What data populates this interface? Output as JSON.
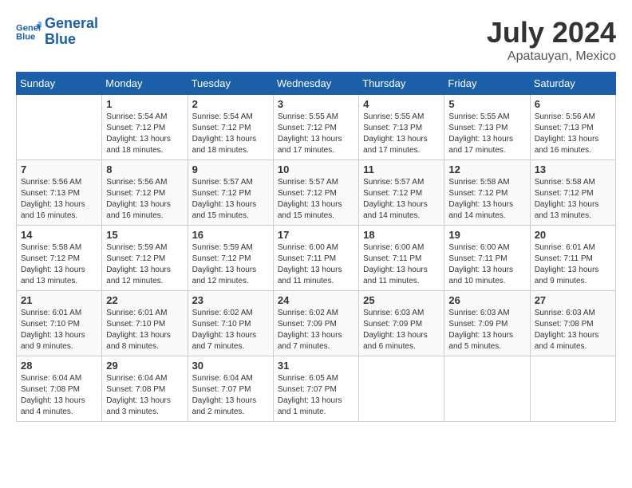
{
  "header": {
    "logo_line1": "General",
    "logo_line2": "Blue",
    "month": "July 2024",
    "location": "Apatauyan, Mexico"
  },
  "days_of_week": [
    "Sunday",
    "Monday",
    "Tuesday",
    "Wednesday",
    "Thursday",
    "Friday",
    "Saturday"
  ],
  "weeks": [
    [
      {
        "day": "",
        "info": ""
      },
      {
        "day": "1",
        "info": "Sunrise: 5:54 AM\nSunset: 7:12 PM\nDaylight: 13 hours\nand 18 minutes."
      },
      {
        "day": "2",
        "info": "Sunrise: 5:54 AM\nSunset: 7:12 PM\nDaylight: 13 hours\nand 18 minutes."
      },
      {
        "day": "3",
        "info": "Sunrise: 5:55 AM\nSunset: 7:12 PM\nDaylight: 13 hours\nand 17 minutes."
      },
      {
        "day": "4",
        "info": "Sunrise: 5:55 AM\nSunset: 7:13 PM\nDaylight: 13 hours\nand 17 minutes."
      },
      {
        "day": "5",
        "info": "Sunrise: 5:55 AM\nSunset: 7:13 PM\nDaylight: 13 hours\nand 17 minutes."
      },
      {
        "day": "6",
        "info": "Sunrise: 5:56 AM\nSunset: 7:13 PM\nDaylight: 13 hours\nand 16 minutes."
      }
    ],
    [
      {
        "day": "7",
        "info": "Sunrise: 5:56 AM\nSunset: 7:13 PM\nDaylight: 13 hours\nand 16 minutes."
      },
      {
        "day": "8",
        "info": "Sunrise: 5:56 AM\nSunset: 7:12 PM\nDaylight: 13 hours\nand 16 minutes."
      },
      {
        "day": "9",
        "info": "Sunrise: 5:57 AM\nSunset: 7:12 PM\nDaylight: 13 hours\nand 15 minutes."
      },
      {
        "day": "10",
        "info": "Sunrise: 5:57 AM\nSunset: 7:12 PM\nDaylight: 13 hours\nand 15 minutes."
      },
      {
        "day": "11",
        "info": "Sunrise: 5:57 AM\nSunset: 7:12 PM\nDaylight: 13 hours\nand 14 minutes."
      },
      {
        "day": "12",
        "info": "Sunrise: 5:58 AM\nSunset: 7:12 PM\nDaylight: 13 hours\nand 14 minutes."
      },
      {
        "day": "13",
        "info": "Sunrise: 5:58 AM\nSunset: 7:12 PM\nDaylight: 13 hours\nand 13 minutes."
      }
    ],
    [
      {
        "day": "14",
        "info": "Sunrise: 5:58 AM\nSunset: 7:12 PM\nDaylight: 13 hours\nand 13 minutes."
      },
      {
        "day": "15",
        "info": "Sunrise: 5:59 AM\nSunset: 7:12 PM\nDaylight: 13 hours\nand 12 minutes."
      },
      {
        "day": "16",
        "info": "Sunrise: 5:59 AM\nSunset: 7:12 PM\nDaylight: 13 hours\nand 12 minutes."
      },
      {
        "day": "17",
        "info": "Sunrise: 6:00 AM\nSunset: 7:11 PM\nDaylight: 13 hours\nand 11 minutes."
      },
      {
        "day": "18",
        "info": "Sunrise: 6:00 AM\nSunset: 7:11 PM\nDaylight: 13 hours\nand 11 minutes."
      },
      {
        "day": "19",
        "info": "Sunrise: 6:00 AM\nSunset: 7:11 PM\nDaylight: 13 hours\nand 10 minutes."
      },
      {
        "day": "20",
        "info": "Sunrise: 6:01 AM\nSunset: 7:11 PM\nDaylight: 13 hours\nand 9 minutes."
      }
    ],
    [
      {
        "day": "21",
        "info": "Sunrise: 6:01 AM\nSunset: 7:10 PM\nDaylight: 13 hours\nand 9 minutes."
      },
      {
        "day": "22",
        "info": "Sunrise: 6:01 AM\nSunset: 7:10 PM\nDaylight: 13 hours\nand 8 minutes."
      },
      {
        "day": "23",
        "info": "Sunrise: 6:02 AM\nSunset: 7:10 PM\nDaylight: 13 hours\nand 7 minutes."
      },
      {
        "day": "24",
        "info": "Sunrise: 6:02 AM\nSunset: 7:09 PM\nDaylight: 13 hours\nand 7 minutes."
      },
      {
        "day": "25",
        "info": "Sunrise: 6:03 AM\nSunset: 7:09 PM\nDaylight: 13 hours\nand 6 minutes."
      },
      {
        "day": "26",
        "info": "Sunrise: 6:03 AM\nSunset: 7:09 PM\nDaylight: 13 hours\nand 5 minutes."
      },
      {
        "day": "27",
        "info": "Sunrise: 6:03 AM\nSunset: 7:08 PM\nDaylight: 13 hours\nand 4 minutes."
      }
    ],
    [
      {
        "day": "28",
        "info": "Sunrise: 6:04 AM\nSunset: 7:08 PM\nDaylight: 13 hours\nand 4 minutes."
      },
      {
        "day": "29",
        "info": "Sunrise: 6:04 AM\nSunset: 7:08 PM\nDaylight: 13 hours\nand 3 minutes."
      },
      {
        "day": "30",
        "info": "Sunrise: 6:04 AM\nSunset: 7:07 PM\nDaylight: 13 hours\nand 2 minutes."
      },
      {
        "day": "31",
        "info": "Sunrise: 6:05 AM\nSunset: 7:07 PM\nDaylight: 13 hours\nand 1 minute."
      },
      {
        "day": "",
        "info": ""
      },
      {
        "day": "",
        "info": ""
      },
      {
        "day": "",
        "info": ""
      }
    ]
  ]
}
